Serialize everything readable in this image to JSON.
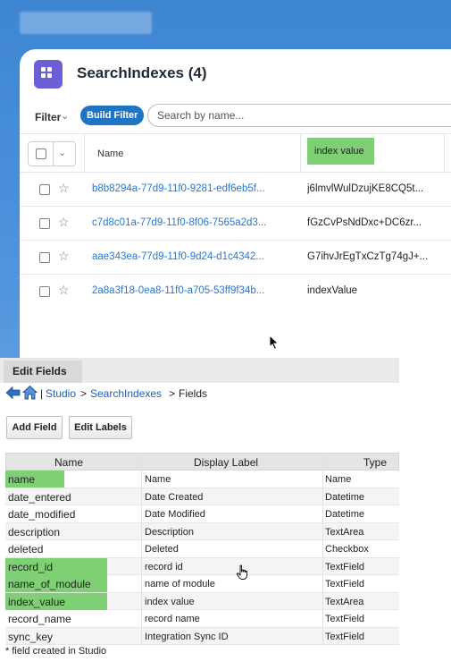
{
  "colors": {
    "accent": "#1f74c4",
    "highlight": "#7fcf75",
    "link": "#2c76c8",
    "app_icon": "#6b5fd6"
  },
  "card": {
    "title": "SearchIndexes (4)",
    "app_icon": "grid-icon",
    "filter_label": "Filter",
    "build_filter_label": "Build Filter",
    "search_placeholder": "Search by name...",
    "columns": {
      "name": "Name",
      "index_value": "index value"
    },
    "rows": [
      {
        "name": "b8b8294a-77d9-11f0-9281-edf6eb5f...",
        "value": "j6lmvlWulDzujKE8CQ5t..."
      },
      {
        "name": "c7d8c01a-77d9-11f0-8f06-7565a2d3...",
        "value": "fGzCvPsNdDxc+DC6zr..."
      },
      {
        "name": "aae343ea-77d9-11f0-9d24-d1c4342...",
        "value": "G7ihvJrEgTxCzTg74gJ+..."
      },
      {
        "name": "2a8a3f18-0ea8-11f0-a705-53ff9f34b...",
        "value": "indexValue"
      }
    ]
  },
  "studio": {
    "tab_label": "Edit Fields",
    "breadcrumb": {
      "separator": "|",
      "studio": "Studio",
      "gt1": ">",
      "module": "SearchIndexes",
      "gt2": ">",
      "current": "Fields"
    },
    "buttons": {
      "add_field": "Add Field",
      "edit_labels": "Edit Labels"
    },
    "headers": {
      "name": "Name",
      "display_label": "Display Label",
      "type": "Type"
    },
    "fields": [
      {
        "name": "name",
        "label": "Name",
        "type": "Name",
        "highlighted": true
      },
      {
        "name": "date_entered",
        "label": "Date Created",
        "type": "Datetime",
        "highlighted": false
      },
      {
        "name": "date_modified",
        "label": "Date Modified",
        "type": "Datetime",
        "highlighted": false
      },
      {
        "name": "description",
        "label": "Description",
        "type": "TextArea",
        "highlighted": false
      },
      {
        "name": "deleted",
        "label": "Deleted",
        "type": "Checkbox",
        "highlighted": false
      },
      {
        "name": "record_id",
        "label": "record id",
        "type": "TextField",
        "highlighted": true
      },
      {
        "name": "name_of_module",
        "label": "name of module",
        "type": "TextField",
        "highlighted": true
      },
      {
        "name": "index_value",
        "label": "index value",
        "type": "TextArea",
        "highlighted": true
      },
      {
        "name": "record_name",
        "label": "record name",
        "type": "TextField",
        "highlighted": false
      },
      {
        "name": "sync_key",
        "label": "Integration Sync ID",
        "type": "TextField",
        "highlighted": false
      }
    ],
    "footnote": "* field created in Studio"
  }
}
